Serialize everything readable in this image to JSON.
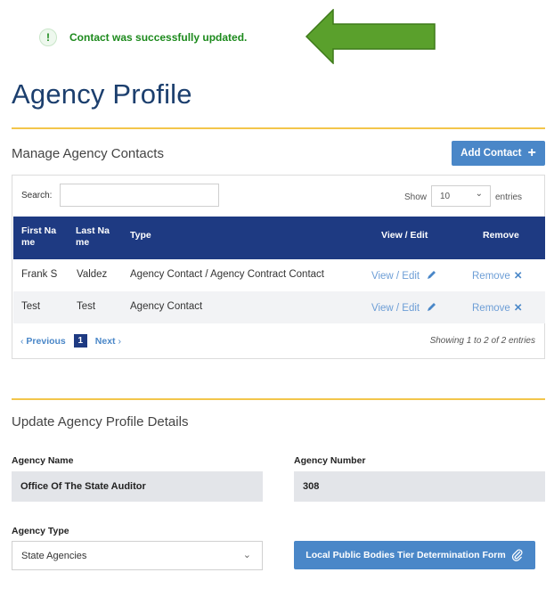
{
  "notification": {
    "icon_glyph": "!",
    "message": "Contact was successfully updated.",
    "arrow_color": "#5aa02c"
  },
  "page": {
    "title": "Agency Profile"
  },
  "contacts": {
    "section_title": "Manage Agency Contacts",
    "add_button_label": "Add Contact",
    "add_button_icon": "+",
    "search_label": "Search:",
    "search_value": "",
    "show_label": "Show",
    "entries_value": "10",
    "entries_label": "entries",
    "columns": [
      "First Na me",
      "Last Na me",
      "Type",
      "View / Edit",
      "Remove"
    ],
    "rows": [
      {
        "first": "Frank S",
        "last": "Valdez",
        "type": "Agency Contact / Agency Contract Contact",
        "view": "View / Edit",
        "remove": "Remove"
      },
      {
        "first": "Test",
        "last": "Test",
        "type": "Agency Contact",
        "view": "View / Edit",
        "remove": "Remove"
      }
    ],
    "pager": {
      "previous": "Previous",
      "page": "1",
      "next": "Next"
    },
    "showing": "Showing 1 to 2 of 2 entries"
  },
  "details": {
    "section_title": "Update Agency Profile Details",
    "agency_name_label": "Agency Name",
    "agency_name_value": "Office Of The State Auditor",
    "agency_number_label": "Agency Number",
    "agency_number_value": "308",
    "agency_type_label": "Agency Type",
    "agency_type_value": "State Agencies",
    "tier_form_button": "Local Public Bodies Tier Determination Form"
  },
  "colors": {
    "accent_gold": "#f3c64b",
    "table_header": "#1e3a82",
    "button_blue": "#4a87c8",
    "success_green": "#1d8a1d"
  }
}
